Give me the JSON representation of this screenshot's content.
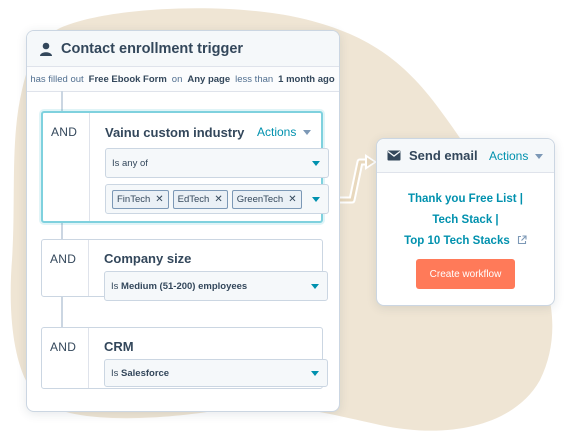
{
  "colors": {
    "accent": "#0091ae",
    "button": "#ff7a59",
    "blob": "#efe5d4",
    "active_border": "#7fd1de"
  },
  "trigger": {
    "icon": "user-icon",
    "title": "Contact enrollment trigger",
    "subline": {
      "p1": "has filled out",
      "form": "Free Ebook Form",
      "p2": "on",
      "page": "Any page",
      "p3": "less than",
      "time": "1 month ago"
    },
    "blocks": [
      {
        "and": "AND",
        "title": "Vainu custom industry",
        "actions": "Actions",
        "operator": "Is any of",
        "tags": [
          "FinTech",
          "EdTech",
          "GreenTech"
        ]
      },
      {
        "and": "AND",
        "title": "Company size",
        "value_prefix": "Is",
        "value": "Medium (51-200) employees"
      },
      {
        "and": "AND",
        "title": "CRM",
        "value_prefix": "Is",
        "value": "Salesforce"
      }
    ]
  },
  "email": {
    "icon": "mail-icon",
    "title": "Send email",
    "actions": "Actions",
    "link_lines": [
      "Thank you Free List |",
      "Tech Stack |",
      "Top 10 Tech Stacks"
    ],
    "external_icon": "external-link-icon",
    "button": "Create workflow"
  }
}
